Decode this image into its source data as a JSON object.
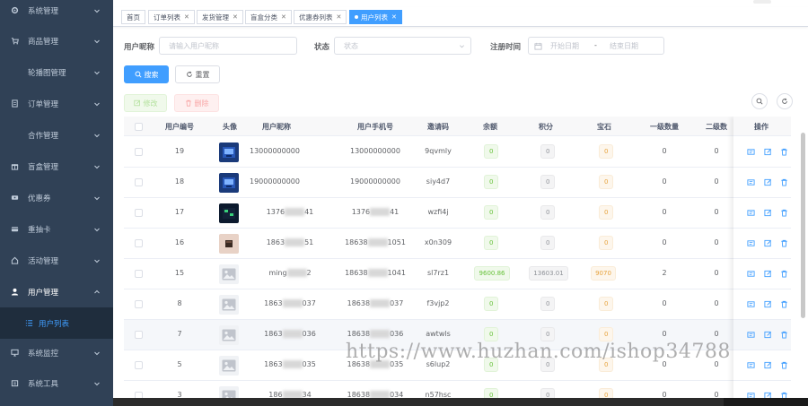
{
  "sidebar": {
    "items": [
      {
        "label": "系统管理",
        "icon": "gear-icon"
      },
      {
        "label": "商品管理",
        "icon": "cart-icon"
      },
      {
        "label": "轮播图管理",
        "icon": ""
      },
      {
        "label": "订单管理",
        "icon": "order-icon"
      },
      {
        "label": "合作管理",
        "icon": ""
      },
      {
        "label": "盲盒管理",
        "icon": "gift-icon"
      },
      {
        "label": "优惠券",
        "icon": "coupon-icon"
      },
      {
        "label": "重抽卡",
        "icon": "card-icon"
      },
      {
        "label": "活动管理",
        "icon": "activity-icon"
      },
      {
        "label": "用户管理",
        "icon": "user-icon"
      },
      {
        "label": "用户列表",
        "icon": "list-icon"
      },
      {
        "label": "系统监控",
        "icon": "monitor-icon"
      },
      {
        "label": "系统工具",
        "icon": "tool-icon"
      }
    ]
  },
  "tags": [
    {
      "label": "首页",
      "closable": false
    },
    {
      "label": "订单列表",
      "closable": true
    },
    {
      "label": "发货管理",
      "closable": true
    },
    {
      "label": "盲盒分类",
      "closable": true
    },
    {
      "label": "优惠券列表",
      "closable": true
    },
    {
      "label": "用户列表",
      "closable": true,
      "active": true
    }
  ],
  "search": {
    "nickname_label": "用户昵称",
    "nickname_placeholder": "请输入用户昵称",
    "status_label": "状态",
    "status_placeholder": "状态",
    "regtime_label": "注册时间",
    "start_placeholder": "开始日期",
    "range_sep": "-",
    "end_placeholder": "结束日期",
    "search_button": "搜索",
    "reset_button": "重置"
  },
  "toolbar": {
    "edit_button": "修改",
    "delete_button": "删除"
  },
  "table": {
    "headers": [
      "用户编号",
      "头像",
      "用户昵称",
      "用户手机号",
      "邀请码",
      "余额",
      "积分",
      "宝石",
      "一级数量",
      "二级数",
      "操作"
    ],
    "rows": [
      {
        "id": "19",
        "avatar": "img",
        "nickname": "13000000000",
        "phone": "13000000000",
        "invite": "9qvmly",
        "balance": "0",
        "points": "0",
        "gems": "0",
        "lv1": "0",
        "lv2": "0"
      },
      {
        "id": "18",
        "avatar": "img",
        "nickname": "19000000000",
        "phone": "19000000000",
        "invite": "siy4d7",
        "balance": "0",
        "points": "0",
        "gems": "0",
        "lv1": "0",
        "lv2": "0"
      },
      {
        "id": "17",
        "avatar": "img2",
        "nickname_a": "1376",
        "nickname_b": "41",
        "phone_a": "1376",
        "phone_b": "41",
        "invite": "wzfi4j",
        "balance": "0",
        "points": "0",
        "gems": "0",
        "lv1": "0",
        "lv2": "0"
      },
      {
        "id": "16",
        "avatar": "img3",
        "nickname_a": "1863",
        "nickname_b": "51",
        "phone_a": "18638",
        "phone_b": "1051",
        "invite": "x0n309",
        "balance": "0",
        "points": "0",
        "gems": "0",
        "lv1": "0",
        "lv2": "0"
      },
      {
        "id": "15",
        "avatar": "ph",
        "nickname_a": "ming",
        "nickname_b": "2",
        "phone_a": "18638",
        "phone_b": "1041",
        "invite": "sl7rz1",
        "balance": "9600.86",
        "points": "13603.01",
        "gems": "9070",
        "lv1": "2",
        "lv2": "0"
      },
      {
        "id": "8",
        "avatar": "ph",
        "nickname_a": "1863",
        "nickname_b": "037",
        "phone_a": "18638",
        "phone_b": "037",
        "invite": "f3vjp2",
        "balance": "0",
        "points": "0",
        "gems": "0",
        "lv1": "0",
        "lv2": "0"
      },
      {
        "id": "7",
        "avatar": "ph",
        "nickname_a": "1863",
        "nickname_b": "036",
        "phone_a": "18638",
        "phone_b": "036",
        "invite": "awtwls",
        "balance": "0",
        "points": "0",
        "gems": "0",
        "lv1": "0",
        "lv2": "0"
      },
      {
        "id": "5",
        "avatar": "ph",
        "nickname_a": "1863",
        "nickname_b": "035",
        "phone_a": "18638",
        "phone_b": "035",
        "invite": "s6lup2",
        "balance": "0",
        "points": "0",
        "gems": "0",
        "lv1": "0",
        "lv2": "0"
      },
      {
        "id": "3",
        "avatar": "ph",
        "nickname_a": "186",
        "nickname_b": "34",
        "phone_a": "18638",
        "phone_b": "034",
        "invite": "n57hsc",
        "balance": "0",
        "points": "0",
        "gems": "0",
        "lv1": "0",
        "lv2": "0"
      }
    ]
  },
  "watermark": "https://www.huzhan.com/ishop34788",
  "colors": {
    "sidebar_bg": "#304156",
    "primary": "#409eff",
    "success": "#67c23a",
    "warning": "#e6a23c",
    "danger": "#f56c6c"
  }
}
